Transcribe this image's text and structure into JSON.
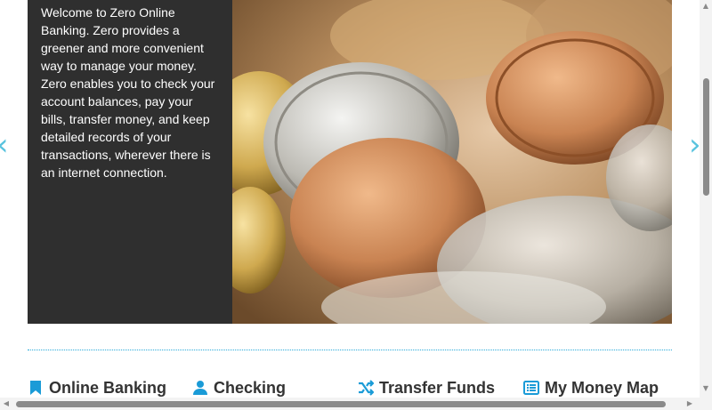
{
  "carousel": {
    "caption": "Welcome to Zero Online Banking. Zero provides a greener and more convenient way to manage your money. Zero enables you to check your account balances, pay your bills, transfer money, and keep detailed records of your transactions, wherever there is an internet connection.",
    "prev_arrow": "‹",
    "next_arrow": "›",
    "image": "coins-photo"
  },
  "features": [
    {
      "label": "Online Banking",
      "icon": "bookmark-icon"
    },
    {
      "label": "Checking",
      "icon": "user-icon"
    },
    {
      "label": "Transfer Funds",
      "icon": "shuffle-icon"
    },
    {
      "label": "My Money Map",
      "icon": "list-alt-icon"
    }
  ],
  "colors": {
    "accent": "#1a9bd7",
    "caption_bg": "#2f2f2f",
    "arrow": "#59c3de"
  },
  "scrollbars": {
    "up": "▲",
    "down": "▼",
    "left": "◀",
    "right": "▶"
  }
}
